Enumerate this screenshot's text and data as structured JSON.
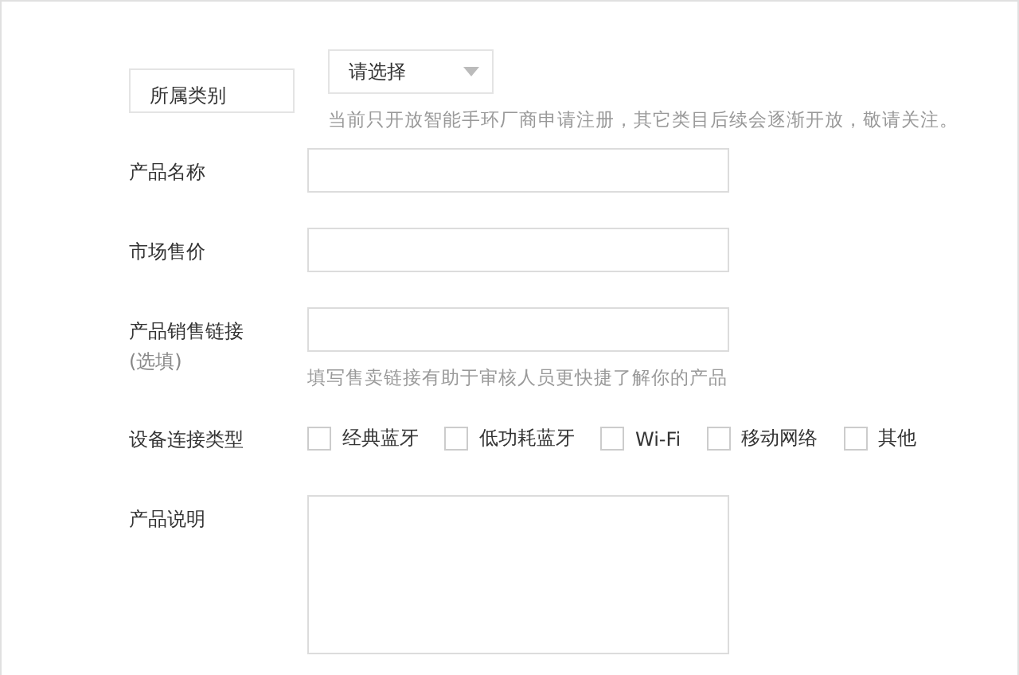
{
  "form": [
    {
      "kind": "select",
      "label": "所属类别",
      "value": "请选择",
      "hint": "当前只开放智能手环厂商申请注册，其它类目后续会逐渐开放，敬请关注。"
    },
    {
      "kind": "text",
      "label": "产品名称"
    },
    {
      "kind": "text",
      "label": "市场售价"
    },
    {
      "kind": "text",
      "label": "产品销售链接",
      "note": "(选填)",
      "hint": "填写售卖链接有助于审核人员更快捷了解你的产品"
    },
    {
      "kind": "checkboxes",
      "label": "设备连接类型",
      "options": [
        {
          "label": "经典蓝牙",
          "checked": false
        },
        {
          "label": "低功耗蓝牙",
          "checked": false
        },
        {
          "label": "Wi-Fi",
          "checked": false
        },
        {
          "label": "移动网络",
          "checked": false
        },
        {
          "label": "其他",
          "checked": false
        }
      ]
    },
    {
      "kind": "textarea",
      "label": "产品说明"
    }
  ]
}
